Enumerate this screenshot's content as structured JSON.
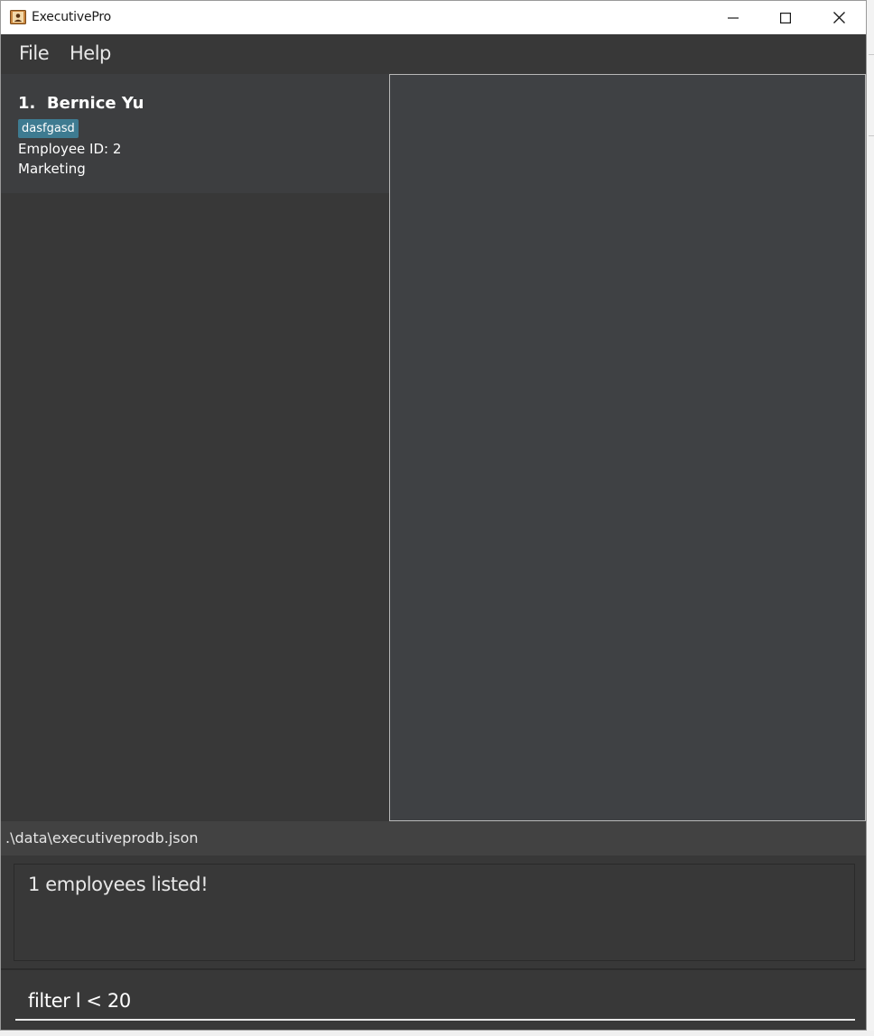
{
  "window": {
    "title": "ExecutivePro"
  },
  "menu": {
    "file": "File",
    "help": "Help"
  },
  "employees": [
    {
      "index": "1.",
      "name": "Bernice Yu",
      "tag": "dasfgasd",
      "employee_id": "Employee ID: 2",
      "department": "Marketing"
    }
  ],
  "status": {
    "file_path": ".\\data\\executiveprodb.json"
  },
  "result": {
    "message": "1 employees listed!"
  },
  "command": {
    "value": "filter l < 20"
  },
  "colors": {
    "background": "#383838",
    "card": "#3d3e40",
    "tag": "#3e7b91",
    "detail_panel": "#3f4144"
  }
}
